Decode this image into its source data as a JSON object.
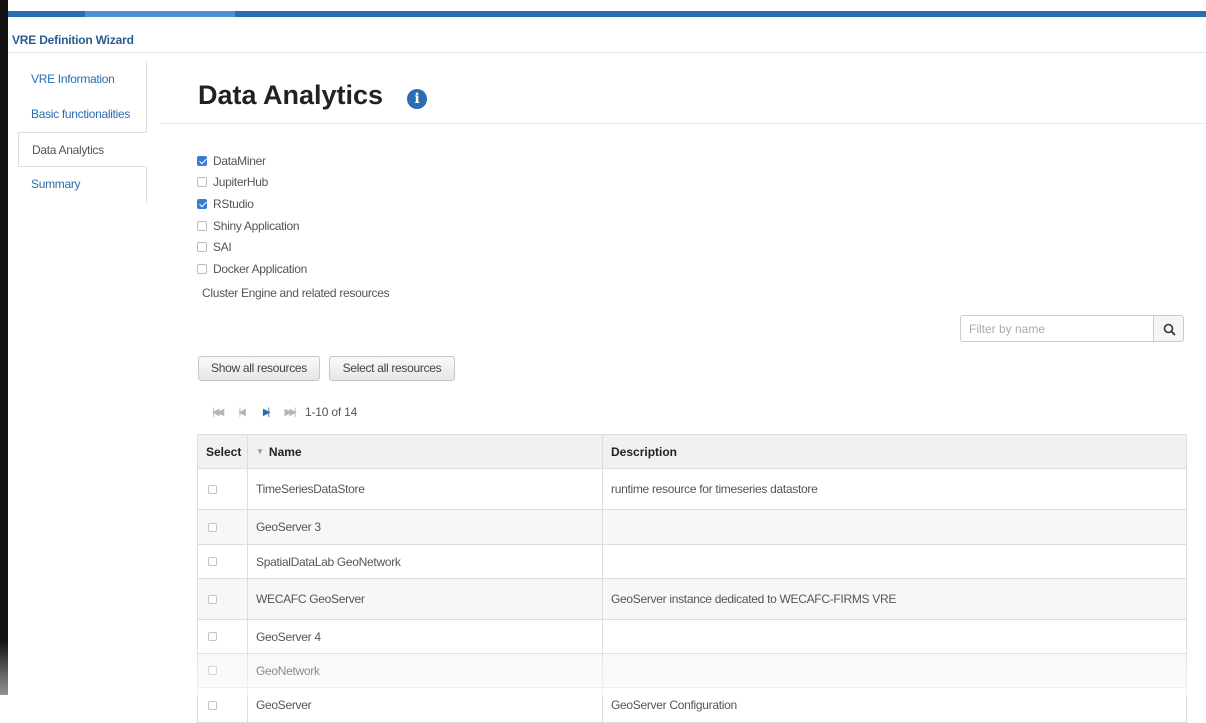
{
  "app": {
    "wizard_title": "VRE Definition Wizard"
  },
  "sidebar": {
    "items": [
      {
        "label": "VRE Information"
      },
      {
        "label": "Basic functionalities"
      },
      {
        "label": "Data Analytics",
        "active": true
      },
      {
        "label": "Summary"
      }
    ]
  },
  "main": {
    "title": "Data Analytics",
    "info_icon": "info-circle-icon",
    "info_glyph": "i",
    "options": [
      {
        "label": "DataMiner",
        "checked": true
      },
      {
        "label": "JupiterHub",
        "checked": false
      },
      {
        "label": "RStudio",
        "checked": true
      },
      {
        "label": "Shiny Application",
        "checked": false
      },
      {
        "label": "SAI",
        "checked": false
      },
      {
        "label": "Docker Application",
        "checked": false
      }
    ],
    "cluster_note": "Cluster Engine and related resources"
  },
  "filter": {
    "placeholder": "Filter by name",
    "icon": "search-icon"
  },
  "buttons": {
    "show_all": "Show all resources",
    "select_all": "Select all resources"
  },
  "pager": {
    "first_glyph": "|◀◀",
    "prev_glyph": "|◀",
    "next_glyph": "▶|",
    "last_glyph": "▶▶|",
    "range_text": "1-10 of 14"
  },
  "table": {
    "headers": {
      "select": "Select",
      "name": "Name",
      "description": "Description"
    },
    "sort_glyph": "▼",
    "rows": [
      {
        "name": "TimeSeriesDataStore",
        "description": "runtime resource for timeseries datastore"
      },
      {
        "name": "GeoServer 3",
        "description": ""
      },
      {
        "name": "SpatialDataLab GeoNetwork",
        "description": ""
      },
      {
        "name": "WECAFC GeoServer",
        "description": "GeoServer instance dedicated to WECAFC-FIRMS VRE"
      },
      {
        "name": "GeoServer 4",
        "description": ""
      },
      {
        "name": "GeoNetwork",
        "description": ""
      },
      {
        "name": "GeoServer",
        "description": "GeoServer Configuration"
      }
    ]
  },
  "colors": {
    "accent": "#2a6db0",
    "topbar": "#2a6db0",
    "checkbox_on": "#3a7bd5"
  }
}
